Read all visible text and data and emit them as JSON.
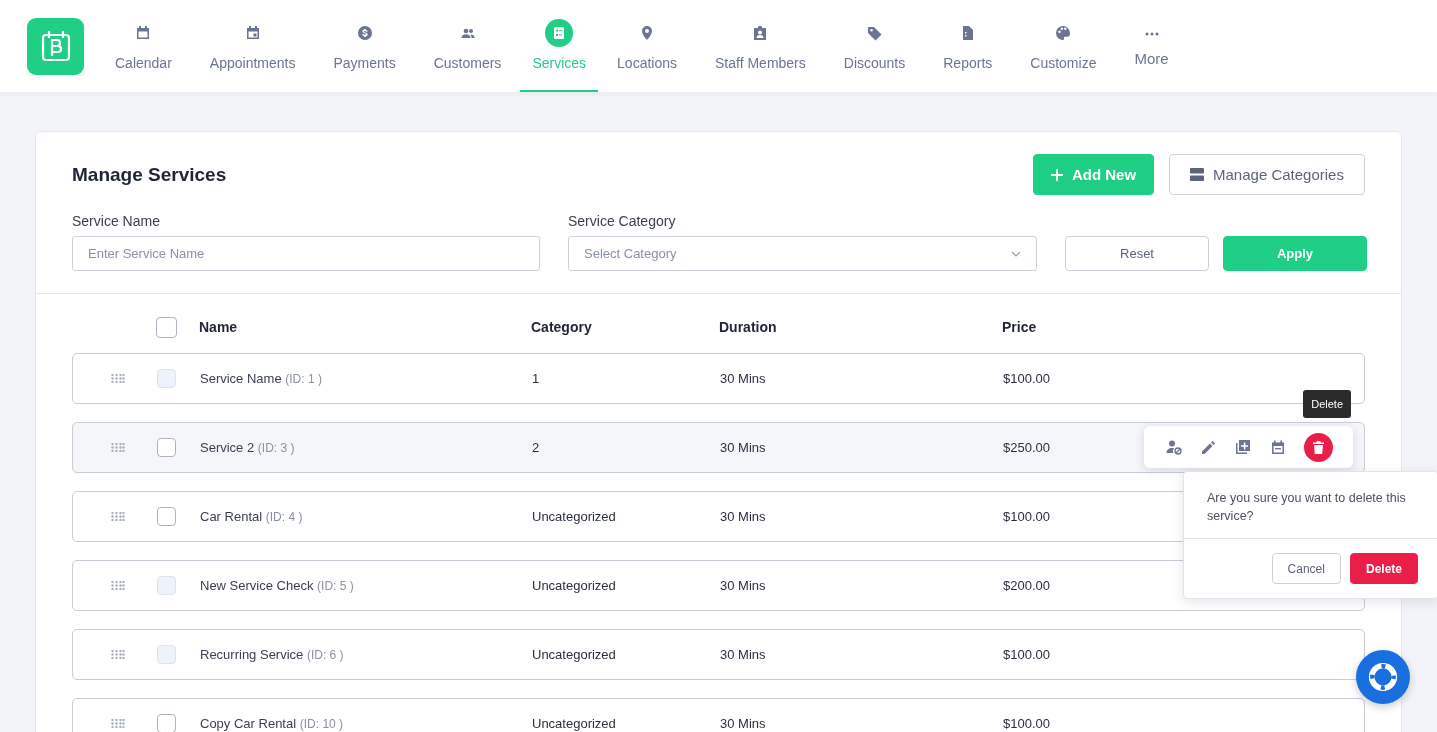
{
  "nav": {
    "items": [
      {
        "label": "Calendar",
        "selected": false
      },
      {
        "label": "Appointments",
        "selected": false
      },
      {
        "label": "Payments",
        "selected": false
      },
      {
        "label": "Customers",
        "selected": false
      },
      {
        "label": "Services",
        "selected": true
      },
      {
        "label": "Locations",
        "selected": false
      },
      {
        "label": "Staff Members",
        "selected": false
      },
      {
        "label": "Discounts",
        "selected": false
      },
      {
        "label": "Reports",
        "selected": false
      },
      {
        "label": "Customize",
        "selected": false
      }
    ],
    "more": "More"
  },
  "panel": {
    "title": "Manage Services",
    "add_button": "Add New",
    "categories_button": "Manage Categories"
  },
  "filters": {
    "name_label": "Service Name",
    "name_placeholder": "Enter Service Name",
    "category_label": "Service Category",
    "category_placeholder": "Select Category",
    "reset": "Reset",
    "apply": "Apply"
  },
  "table": {
    "columns": [
      "Name",
      "Category",
      "Duration",
      "Price"
    ],
    "header_checked": false,
    "rows": [
      {
        "name": "Service Name",
        "id_text": "(ID: 1 )",
        "category": "1",
        "duration": "30 Mins",
        "price": "$100.00",
        "checked": false,
        "disabled": true,
        "highlighted": false
      },
      {
        "name": "Service 2",
        "id_text": "(ID: 3 )",
        "category": "2",
        "duration": "30 Mins",
        "price": "$250.00",
        "checked": false,
        "disabled": false,
        "highlighted": true
      },
      {
        "name": "Car Rental",
        "id_text": "(ID: 4 )",
        "category": "Uncategorized",
        "duration": "30 Mins",
        "price": "$100.00",
        "checked": false,
        "disabled": false,
        "highlighted": false
      },
      {
        "name": "New Service Check",
        "id_text": "(ID: 5 )",
        "category": "Uncategorized",
        "duration": "30 Mins",
        "price": "$200.00",
        "checked": false,
        "disabled": true,
        "highlighted": false
      },
      {
        "name": "Recurring Service",
        "id_text": "(ID: 6 )",
        "category": "Uncategorized",
        "duration": "30 Mins",
        "price": "$100.00",
        "checked": false,
        "disabled": true,
        "highlighted": false
      },
      {
        "name": "Copy Car Rental",
        "id_text": "(ID: 10 )",
        "category": "Uncategorized",
        "duration": "30 Mins",
        "price": "$100.00",
        "checked": false,
        "disabled": false,
        "highlighted": false
      }
    ]
  },
  "row_actions": {
    "tooltip": "Delete"
  },
  "confirm": {
    "message": "Are you sure you want to delete this service?",
    "cancel": "Cancel",
    "confirm": "Delete"
  }
}
